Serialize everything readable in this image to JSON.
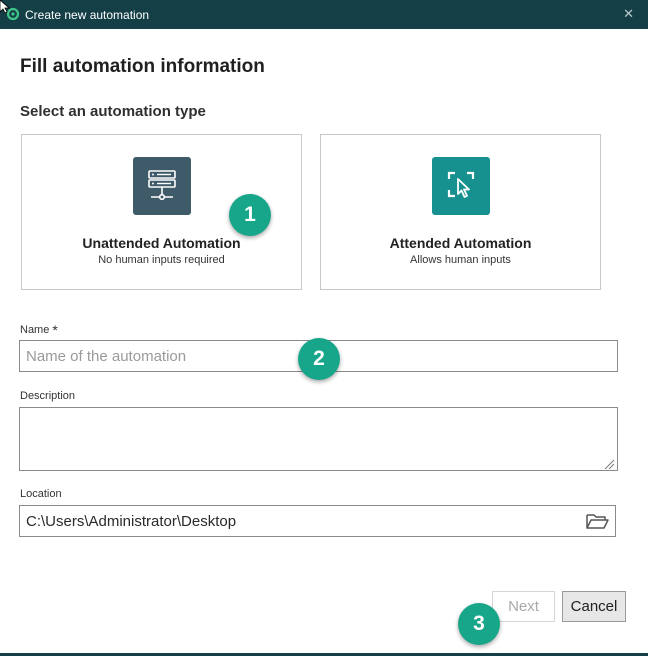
{
  "window": {
    "title": "Create new automation",
    "close_glyph": "✕"
  },
  "heading": "Fill automation information",
  "type_section": {
    "label": "Select an automation type",
    "options": [
      {
        "title": "Unattended Automation",
        "subtitle": "No human inputs required",
        "icon": "server-icon",
        "color": "#3f5a68"
      },
      {
        "title": "Attended Automation",
        "subtitle": "Allows human inputs",
        "icon": "cursor-select-icon",
        "color": "#179090"
      }
    ]
  },
  "fields": {
    "name": {
      "label": "Name",
      "required_mark": "*",
      "placeholder": "Name of the automation",
      "value": ""
    },
    "description": {
      "label": "Description",
      "value": ""
    },
    "location": {
      "label": "Location",
      "value": "C:\\Users\\Administrator\\Desktop"
    }
  },
  "buttons": {
    "next": "Next",
    "cancel": "Cancel"
  },
  "callouts": [
    "1",
    "2",
    "3"
  ],
  "colors": {
    "titlebar": "#153f47",
    "accent": "#17a68a",
    "unattended_tile": "#3f5a68",
    "attended_tile": "#179090"
  }
}
